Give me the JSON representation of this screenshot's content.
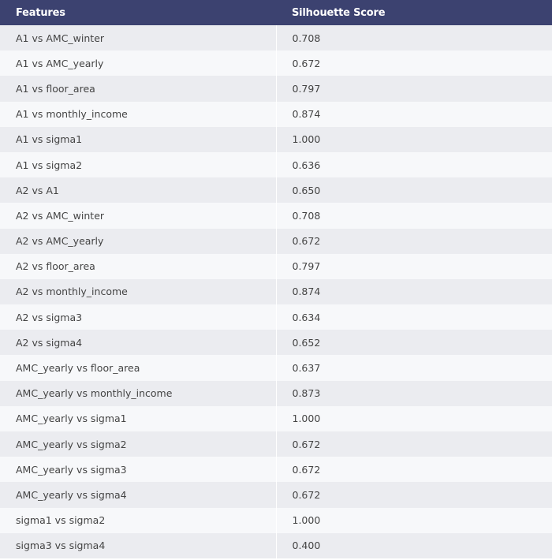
{
  "chart_data": {
    "type": "table",
    "columns": [
      "Features",
      "Silhouette Score"
    ],
    "rows": [
      [
        "A1 vs AMC_winter",
        "0.708"
      ],
      [
        "A1 vs AMC_yearly",
        "0.672"
      ],
      [
        "A1 vs floor_area",
        "0.797"
      ],
      [
        "A1 vs monthly_income",
        "0.874"
      ],
      [
        "A1 vs sigma1",
        "1.000"
      ],
      [
        "A1 vs sigma2",
        "0.636"
      ],
      [
        "A2 vs A1",
        "0.650"
      ],
      [
        "A2 vs AMC_winter",
        "0.708"
      ],
      [
        "A2 vs AMC_yearly",
        "0.672"
      ],
      [
        "A2 vs floor_area",
        "0.797"
      ],
      [
        "A2 vs monthly_income",
        "0.874"
      ],
      [
        "A2 vs sigma3",
        "0.634"
      ],
      [
        "A2 vs sigma4",
        "0.652"
      ],
      [
        "AMC_yearly vs floor_area",
        "0.637"
      ],
      [
        "AMC_yearly vs monthly_income",
        "0.873"
      ],
      [
        "AMC_yearly vs sigma1",
        "1.000"
      ],
      [
        "AMC_yearly vs sigma2",
        "0.672"
      ],
      [
        "AMC_yearly vs sigma3",
        "0.672"
      ],
      [
        "AMC_yearly vs sigma4",
        "0.672"
      ],
      [
        "sigma1 vs sigma2",
        "1.000"
      ],
      [
        "sigma3 vs sigma4",
        "0.400"
      ]
    ]
  },
  "colors": {
    "header_bg": "#3c4270",
    "header_text": "#ffffff",
    "row_odd": "#ebecf0",
    "row_even": "#f7f8fa",
    "cell_text": "#444444"
  }
}
